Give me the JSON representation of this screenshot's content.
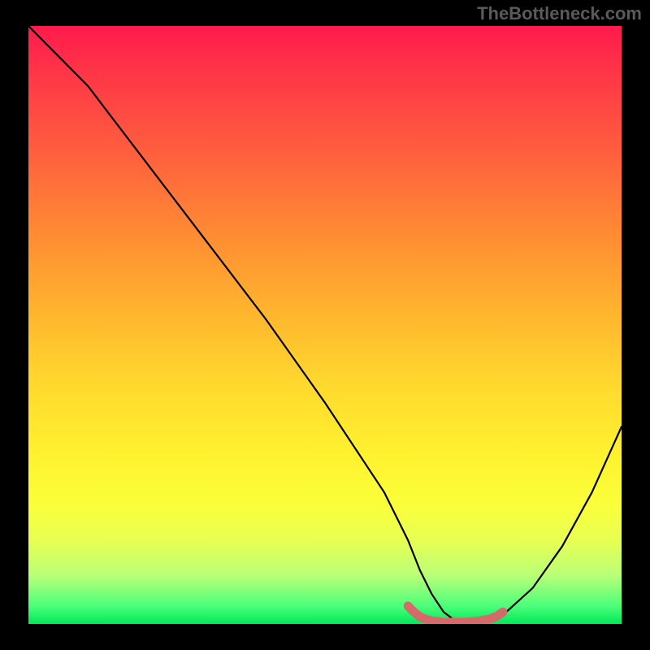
{
  "watermark": "TheBottleneck.com",
  "chart_data": {
    "type": "line",
    "title": "",
    "xlabel": "",
    "ylabel": "",
    "xlim": [
      0,
      100
    ],
    "ylim": [
      0,
      100
    ],
    "series": [
      {
        "name": "bottleneck-curve",
        "x": [
          0,
          4,
          10,
          20,
          30,
          40,
          50,
          60,
          64,
          66,
          68,
          70,
          72,
          74,
          76,
          78,
          80,
          85,
          90,
          95,
          100
        ],
        "values": [
          100,
          96,
          90,
          77,
          64,
          51,
          37,
          22,
          14,
          9,
          5,
          2,
          0.5,
          0.5,
          0.5,
          0.5,
          1.5,
          6,
          13,
          22,
          33
        ]
      },
      {
        "name": "optimal-range-marker",
        "x": [
          64,
          65,
          66,
          67,
          68,
          69,
          70,
          71,
          72,
          73,
          74,
          75,
          76,
          77,
          78,
          79,
          80
        ],
        "values": [
          3.0,
          2.0,
          1.2,
          0.8,
          0.5,
          0.4,
          0.3,
          0.3,
          0.3,
          0.3,
          0.3,
          0.4,
          0.5,
          0.7,
          0.9,
          1.3,
          2.0
        ]
      }
    ],
    "gradient_stops": [
      {
        "pos": 0,
        "color": "#ff1a4d"
      },
      {
        "pos": 8,
        "color": "#ff3647"
      },
      {
        "pos": 20,
        "color": "#ff5b3f"
      },
      {
        "pos": 35,
        "color": "#ff8c33"
      },
      {
        "pos": 48,
        "color": "#ffb52e"
      },
      {
        "pos": 60,
        "color": "#ffd92e"
      },
      {
        "pos": 72,
        "color": "#fff22f"
      },
      {
        "pos": 80,
        "color": "#faff3a"
      },
      {
        "pos": 86,
        "color": "#e8ff52"
      },
      {
        "pos": 92,
        "color": "#b8ff78"
      },
      {
        "pos": 97,
        "color": "#4cff7a"
      },
      {
        "pos": 100,
        "color": "#00e858"
      }
    ]
  }
}
